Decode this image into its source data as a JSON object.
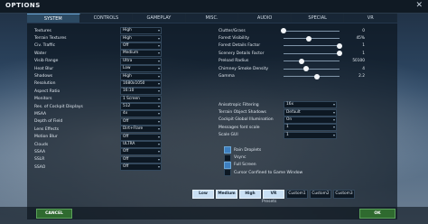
{
  "window": {
    "title": "OPTIONS",
    "close_glyph": "✕"
  },
  "tabs": [
    {
      "label": "SYSTEM",
      "active": true
    },
    {
      "label": "CONTROLS",
      "active": false
    },
    {
      "label": "GAMEPLAY",
      "active": false
    },
    {
      "label": "MISC.",
      "active": false
    },
    {
      "label": "AUDIO",
      "active": false
    },
    {
      "label": "SPECIAL",
      "active": false
    },
    {
      "label": "VR",
      "active": false
    }
  ],
  "left_settings": [
    {
      "label": "Textures",
      "value": "High"
    },
    {
      "label": "Terrain Textures",
      "value": "High"
    },
    {
      "label": "Civ. Traffic",
      "value": "Off"
    },
    {
      "label": "Water",
      "value": "Medium"
    },
    {
      "label": "Visib Range",
      "value": "Ultra"
    },
    {
      "label": "Heat Blur",
      "value": "Low"
    },
    {
      "label": "Shadows",
      "value": "High"
    },
    {
      "label": "Resolution",
      "value": "1680x1050"
    },
    {
      "label": "Aspect Ratio",
      "value": "16:10"
    },
    {
      "label": "Monitors",
      "value": "1 Screen"
    },
    {
      "label": "Res. of Cockpit Displays",
      "value": "512"
    },
    {
      "label": "MSAA",
      "value": "4x"
    },
    {
      "label": "Depth of Field",
      "value": "Off"
    },
    {
      "label": "Lens Effects",
      "value": "Dirt+Flare"
    },
    {
      "label": "Motion Blur",
      "value": "Off"
    },
    {
      "label": "Clouds",
      "value": "ULTRA"
    },
    {
      "label": "SSAA",
      "value": "Off"
    },
    {
      "label": "SSLR",
      "value": "Off"
    },
    {
      "label": "SSAO",
      "value": "Off"
    }
  ],
  "sliders": [
    {
      "label": "Clutter/Grass",
      "value": "0",
      "level": 0.0
    },
    {
      "label": "Forest Visibility",
      "value": "45%",
      "level": 0.45
    },
    {
      "label": "Forest Details Factor",
      "value": "1",
      "level": 1.0
    },
    {
      "label": "Scenery Details Factor",
      "value": "1",
      "level": 1.0
    },
    {
      "label": "Preload Radius",
      "value": "50100",
      "level": 0.33
    },
    {
      "label": "Chimney Smoke Density",
      "value": "4",
      "level": 0.4
    },
    {
      "label": "Gamma",
      "value": "2.2",
      "level": 0.6
    }
  ],
  "right_dropdowns": [
    {
      "label": "Anisotropic Filtering",
      "value": "16x"
    },
    {
      "label": "Terrain Object Shadows",
      "value": "Default"
    },
    {
      "label": "Cockpit Global Illumination",
      "value": "On"
    },
    {
      "label": "Messages font scale",
      "value": "1"
    },
    {
      "label": "Scale GUI",
      "value": "1"
    }
  ],
  "checkboxes": [
    {
      "label": "Rain Droplets",
      "checked": true
    },
    {
      "label": "Vsync",
      "checked": false
    },
    {
      "label": "Full Screen",
      "checked": true
    },
    {
      "label": "Cursor Confined to Game Window",
      "checked": false
    }
  ],
  "presets": {
    "label": "Presets",
    "buttons": [
      {
        "label": "Low",
        "highlight": true
      },
      {
        "label": "Medium",
        "highlight": true
      },
      {
        "label": "High",
        "highlight": true
      },
      {
        "label": "VR",
        "highlight": true
      },
      {
        "label": "Custom1",
        "highlight": false
      },
      {
        "label": "Custom2",
        "highlight": false
      },
      {
        "label": "Custom3",
        "highlight": false
      }
    ]
  },
  "footer": {
    "cancel_label": "CANCEL",
    "ok_label": "OK"
  }
}
